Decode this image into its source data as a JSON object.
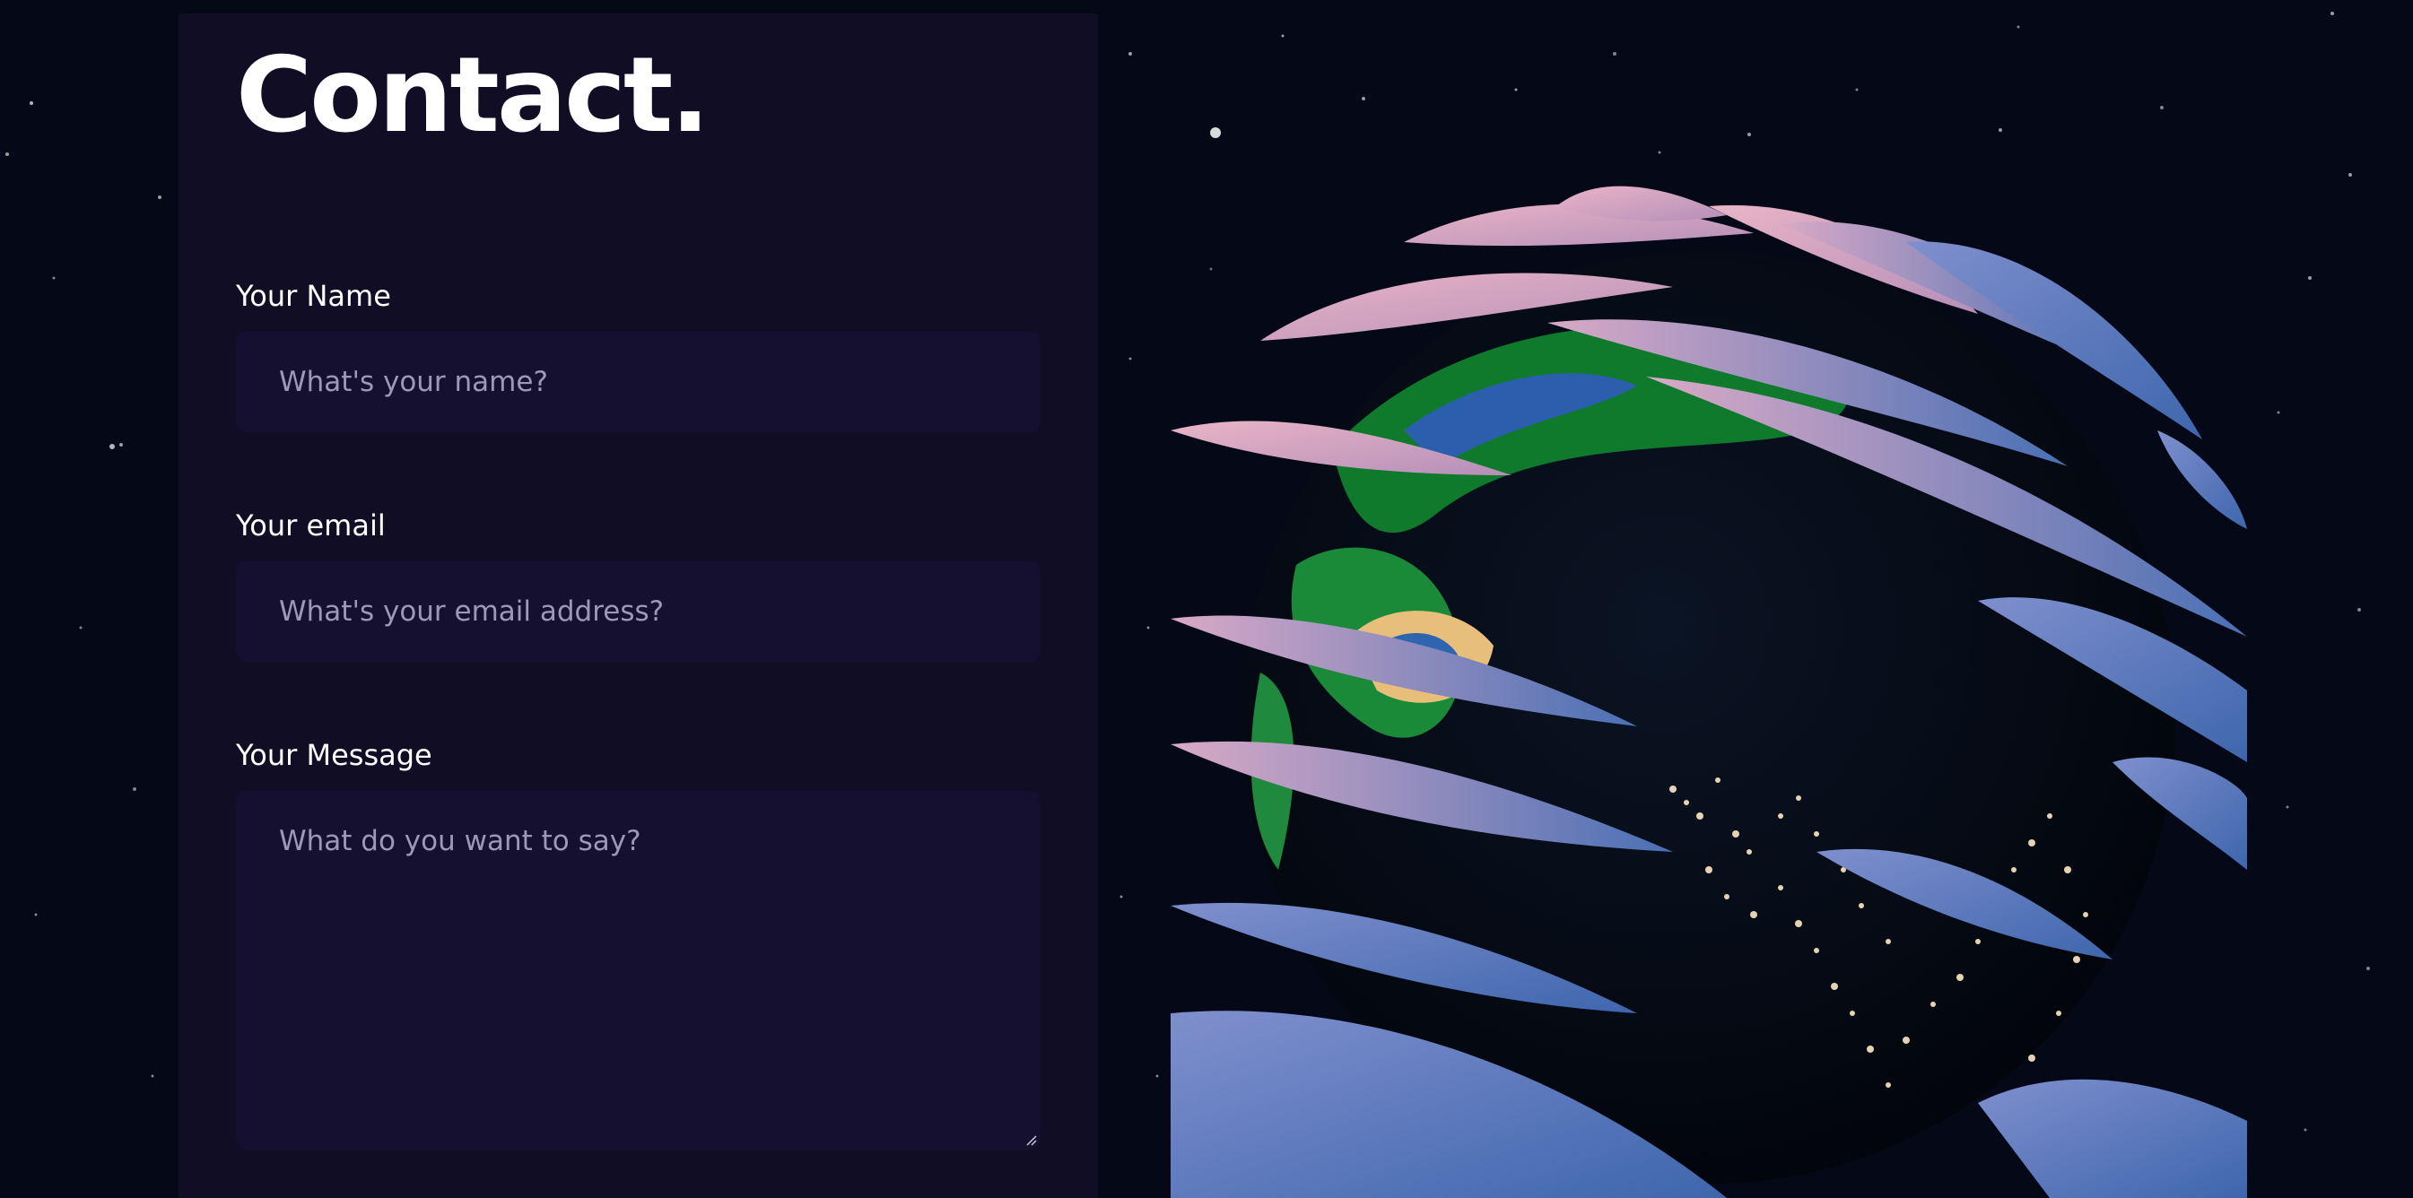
{
  "contact": {
    "title": "Contact.",
    "name_label": "Your Name",
    "name_placeholder": "What's your name?",
    "email_label": "Your email",
    "email_placeholder": "What's your email address?",
    "message_label": "Your Message",
    "message_placeholder": "What do you want to say?"
  },
  "colors": {
    "background": "#050816",
    "card": "#100d25",
    "input": "#151030",
    "placeholder": "#9d98b8"
  },
  "icons": {
    "resize_handle": "resize-grip-icon",
    "globe": "earth-globe-illustration"
  }
}
